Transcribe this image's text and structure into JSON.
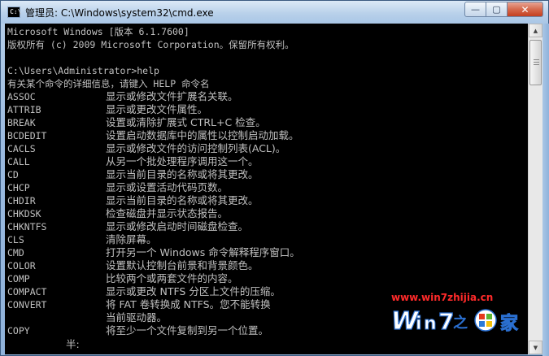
{
  "window": {
    "title": "管理员: C:\\Windows\\system32\\cmd.exe",
    "controls": {
      "minimize": "—",
      "maximize": "▢",
      "close": "✕"
    }
  },
  "console": {
    "header_lines": [
      "Microsoft Windows [版本 6.1.7600]",
      "版权所有 (c) 2009 Microsoft Corporation。保留所有权利。",
      "",
      "C:\\Users\\Administrator>help",
      "有关某个命令的详细信息，请键入 HELP 命令名"
    ],
    "commands": [
      {
        "name": "ASSOC",
        "desc": "显示或修改文件扩展名关联。"
      },
      {
        "name": "ATTRIB",
        "desc": "显示或更改文件属性。"
      },
      {
        "name": "BREAK",
        "desc": "设置或清除扩展式 CTRL+C 检查。"
      },
      {
        "name": "BCDEDIT",
        "desc": "设置启动数据库中的属性以控制启动加载。"
      },
      {
        "name": "CACLS",
        "desc": "显示或修改文件的访问控制列表(ACL)。"
      },
      {
        "name": "CALL",
        "desc": "从另一个批处理程序调用这一个。"
      },
      {
        "name": "CD",
        "desc": "显示当前目录的名称或将其更改。"
      },
      {
        "name": "CHCP",
        "desc": "显示或设置活动代码页数。"
      },
      {
        "name": "CHDIR",
        "desc": "显示当前目录的名称或将其更改。"
      },
      {
        "name": "CHKDSK",
        "desc": "检查磁盘并显示状态报告。"
      },
      {
        "name": "CHKNTFS",
        "desc": "显示或修改启动时间磁盘检查。"
      },
      {
        "name": "CLS",
        "desc": "清除屏幕。"
      },
      {
        "name": "CMD",
        "desc": "打开另一个 Windows 命令解释程序窗口。"
      },
      {
        "name": "COLOR",
        "desc": "设置默认控制台前景和背景颜色。"
      },
      {
        "name": "COMP",
        "desc": "比较两个或两套文件的内容。"
      },
      {
        "name": "COMPACT",
        "desc": "显示或更改 NTFS 分区上文件的压缩。"
      },
      {
        "name": "CONVERT",
        "desc": "将 FAT 卷转换成 NTFS。您不能转换"
      },
      {
        "name": "",
        "desc": "当前驱动器。"
      },
      {
        "name": "COPY",
        "desc": "将至少一个文件复制到另一个位置。"
      }
    ],
    "ime_status": "半:"
  },
  "scrollbar": {
    "up": "▲",
    "down": "▼"
  },
  "watermark": {
    "url": "www.win7zhijia.cn"
  },
  "colors": {
    "console_bg": "#000000",
    "console_text": "#c0c0c0",
    "watermark": "#ff2a2a"
  }
}
